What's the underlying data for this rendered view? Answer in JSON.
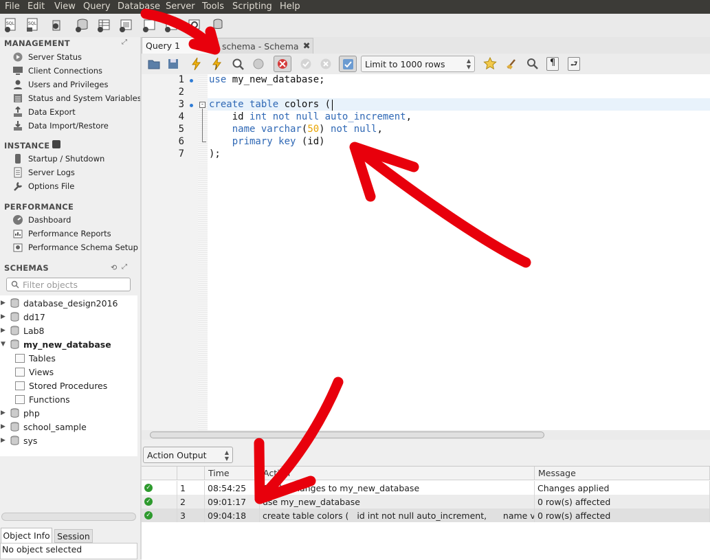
{
  "menu": [
    "File",
    "Edit",
    "View",
    "Query",
    "Database",
    "Server",
    "Tools",
    "Scripting",
    "Help"
  ],
  "sidebar": {
    "management": {
      "title": "MANAGEMENT",
      "items": [
        "Server Status",
        "Client Connections",
        "Users and Privileges",
        "Status and System Variables",
        "Data Export",
        "Data Import/Restore"
      ]
    },
    "instance": {
      "title": "INSTANCE",
      "items": [
        "Startup / Shutdown",
        "Server Logs",
        "Options File"
      ]
    },
    "performance": {
      "title": "PERFORMANCE",
      "items": [
        "Dashboard",
        "Performance Reports",
        "Performance Schema Setup"
      ]
    },
    "schemas": {
      "title": "SCHEMAS",
      "filter_placeholder": "Filter objects",
      "list": [
        "database_design2016",
        "dd17",
        "Lab8",
        "my_new_database",
        "php",
        "school_sample",
        "sys"
      ],
      "expanded": "my_new_database",
      "children": [
        "Tables",
        "Views",
        "Stored Procedures",
        "Functions"
      ]
    }
  },
  "tabs": [
    {
      "label": "Query 1"
    },
    {
      "label": "schema - Schema"
    }
  ],
  "query_toolbar": {
    "limit_label": "Limit to 1000 rows"
  },
  "editor": {
    "line_numbers": [
      "1",
      "2",
      "3",
      "4",
      "5",
      "6",
      "7"
    ],
    "lines": [
      "use my_new_database;",
      "",
      "create table colors (",
      "    id int not null auto_increment,",
      "    name varchar(50) not null,",
      "    primary key (id)",
      ");"
    ]
  },
  "output": {
    "selector": "Action Output",
    "columns": [
      "",
      "",
      "Time",
      "Action",
      "Message"
    ],
    "rows": [
      {
        "num": "1",
        "time": "08:54:25",
        "action": "Apply changes to my_new_database",
        "message": "Changes applied"
      },
      {
        "num": "2",
        "time": "09:01:17",
        "action": "use my_new_database",
        "message": "0 row(s) affected"
      },
      {
        "num": "3",
        "time": "09:04:18",
        "action": "create table colors (   id int not null auto_increment,      name v...",
        "message": "0 row(s) affected"
      }
    ]
  },
  "object_info": {
    "tabs": [
      "Object Info",
      "Session"
    ],
    "body": "No object selected"
  },
  "colors": {
    "annotation": "#e8000c",
    "keyword": "#2f68b5",
    "number": "#e8a400",
    "menubar": "#3c3b37"
  }
}
